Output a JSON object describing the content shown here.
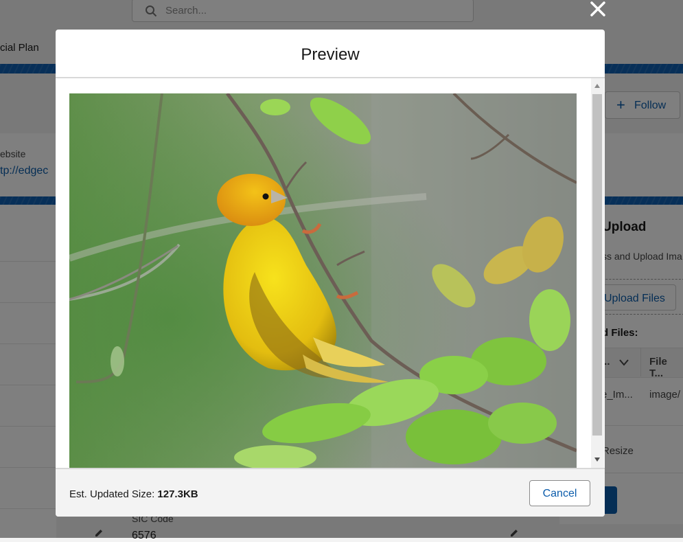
{
  "background": {
    "search_placeholder": "Search...",
    "nav_label": "cial Plan",
    "follow_label": "Follow",
    "website_label": "ebsite",
    "website_value": "tp://edgec",
    "upload_title": "Upload",
    "upload_desc": "ss and Upload Ima",
    "upload_button": "Upload Files",
    "files_label": "d Files:",
    "table_headers": [
      "...",
      "File T..."
    ],
    "table_row": [
      "e_Im...",
      "image/"
    ],
    "resize_label": "Resize",
    "sic_label": "SIC Code",
    "sic_value": "6576"
  },
  "modal": {
    "title": "Preview",
    "image_subject": "yellow bird perched on a branch",
    "footer": {
      "size_label": "Est. Updated Size:",
      "size_value": "127.3KB",
      "cancel_label": "Cancel"
    }
  },
  "colors": {
    "brand_blue": "#0b5cab",
    "overlay": "rgba(0,0,0,0.5)"
  }
}
